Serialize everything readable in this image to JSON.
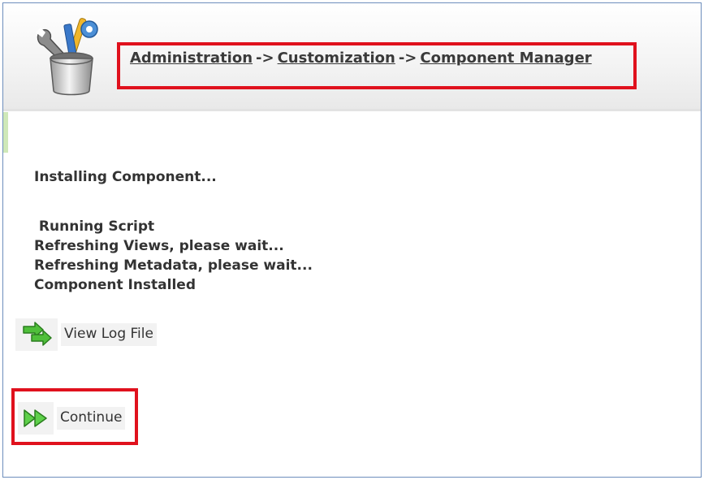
{
  "header": {
    "icon": "tools-cup-icon",
    "breadcrumb": {
      "items": [
        "Administration",
        "Customization",
        "Component Manager"
      ],
      "separator": "->"
    },
    "highlight_color": "#e0111d"
  },
  "status": {
    "heading": "Installing Component...",
    "log_lines": [
      " Running Script",
      "Refreshing Views, please wait...",
      "Refreshing Metadata, please wait...",
      "Component Installed"
    ]
  },
  "actions": {
    "view_log": {
      "label": "View Log File",
      "icon": "green-arrows-icon"
    },
    "continue": {
      "label": "Continue",
      "icon": "fast-forward-icon"
    }
  }
}
